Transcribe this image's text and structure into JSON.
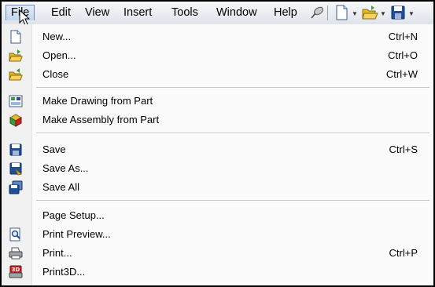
{
  "menubar": {
    "items": [
      {
        "label": "File"
      },
      {
        "label": "Edit"
      },
      {
        "label": "View"
      },
      {
        "label": "Insert"
      },
      {
        "label": "Tools"
      },
      {
        "label": "Window"
      },
      {
        "label": "Help"
      }
    ],
    "toolbar_icons": [
      "pushpin-icon",
      "new-document-icon",
      "open-folder-icon",
      "save-icon"
    ]
  },
  "file_menu": {
    "sections": [
      {
        "items": [
          {
            "label": "New...",
            "shortcut": "Ctrl+N",
            "icon": "new-document-icon"
          },
          {
            "label": "Open...",
            "shortcut": "Ctrl+O",
            "icon": "open-folder-icon"
          },
          {
            "label": "Close",
            "shortcut": "Ctrl+W",
            "icon": "close-folder-icon"
          }
        ]
      },
      {
        "items": [
          {
            "label": "Make Drawing from Part",
            "shortcut": "",
            "icon": "make-drawing-icon"
          },
          {
            "label": "Make Assembly from Part",
            "shortcut": "",
            "icon": "make-assembly-icon"
          }
        ]
      },
      {
        "items": [
          {
            "label": "Save",
            "shortcut": "Ctrl+S",
            "icon": "save-icon"
          },
          {
            "label": "Save As...",
            "shortcut": "",
            "icon": "save-as-icon"
          },
          {
            "label": "Save All",
            "shortcut": "",
            "icon": "save-all-icon"
          }
        ]
      },
      {
        "items": [
          {
            "label": "Page Setup...",
            "shortcut": "",
            "icon": ""
          },
          {
            "label": "Print Preview...",
            "shortcut": "",
            "icon": "print-preview-icon"
          },
          {
            "label": "Print...",
            "shortcut": "Ctrl+P",
            "icon": "printer-icon"
          },
          {
            "label": "Print3D...",
            "shortcut": "",
            "icon": "print3d-icon"
          }
        ]
      }
    ]
  },
  "colors": {
    "menubar_bg": "#dfe3ea",
    "active_menu_border": "#6f8fbd",
    "icon_blue": "#1f4f96",
    "icon_folder_yellow": "#e8b923",
    "icon_green": "#3a9b3a",
    "icon_red": "#cc2222"
  }
}
